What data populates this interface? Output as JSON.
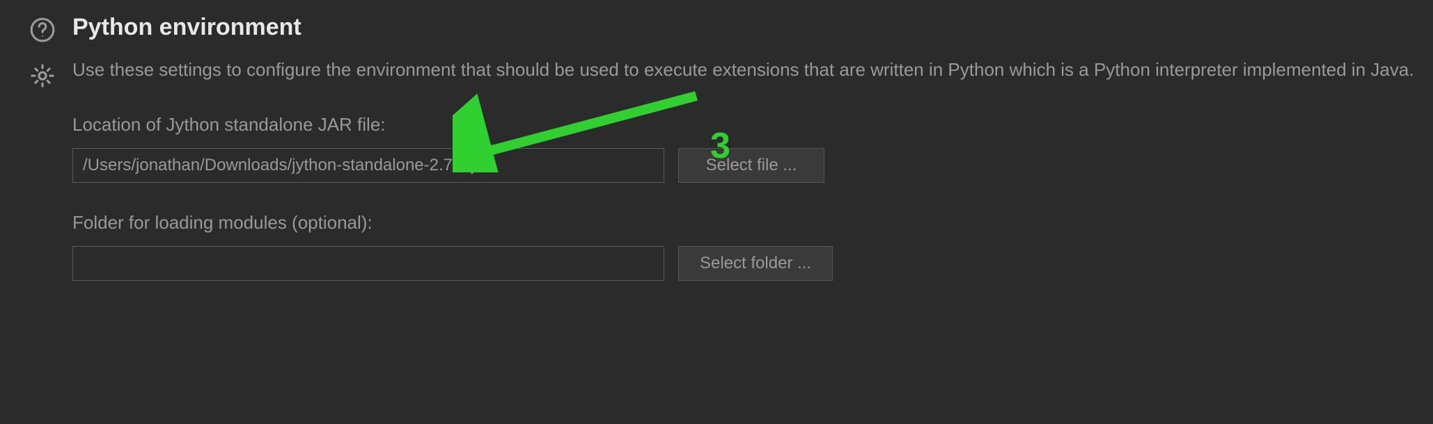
{
  "section": {
    "title": "Python environment",
    "description": "Use these settings to configure the environment that should be used to execute extensions that are written in Python which is a Python interpreter implemented in Java."
  },
  "fields": {
    "jar": {
      "label": "Location of Jython standalone JAR file:",
      "value": "/Users/jonathan/Downloads/jython-standalone-2.7.3.jar",
      "button": "Select file ..."
    },
    "modules": {
      "label": "Folder for loading modules (optional):",
      "value": "",
      "button": "Select folder ..."
    }
  },
  "annotation": {
    "number": "3"
  }
}
